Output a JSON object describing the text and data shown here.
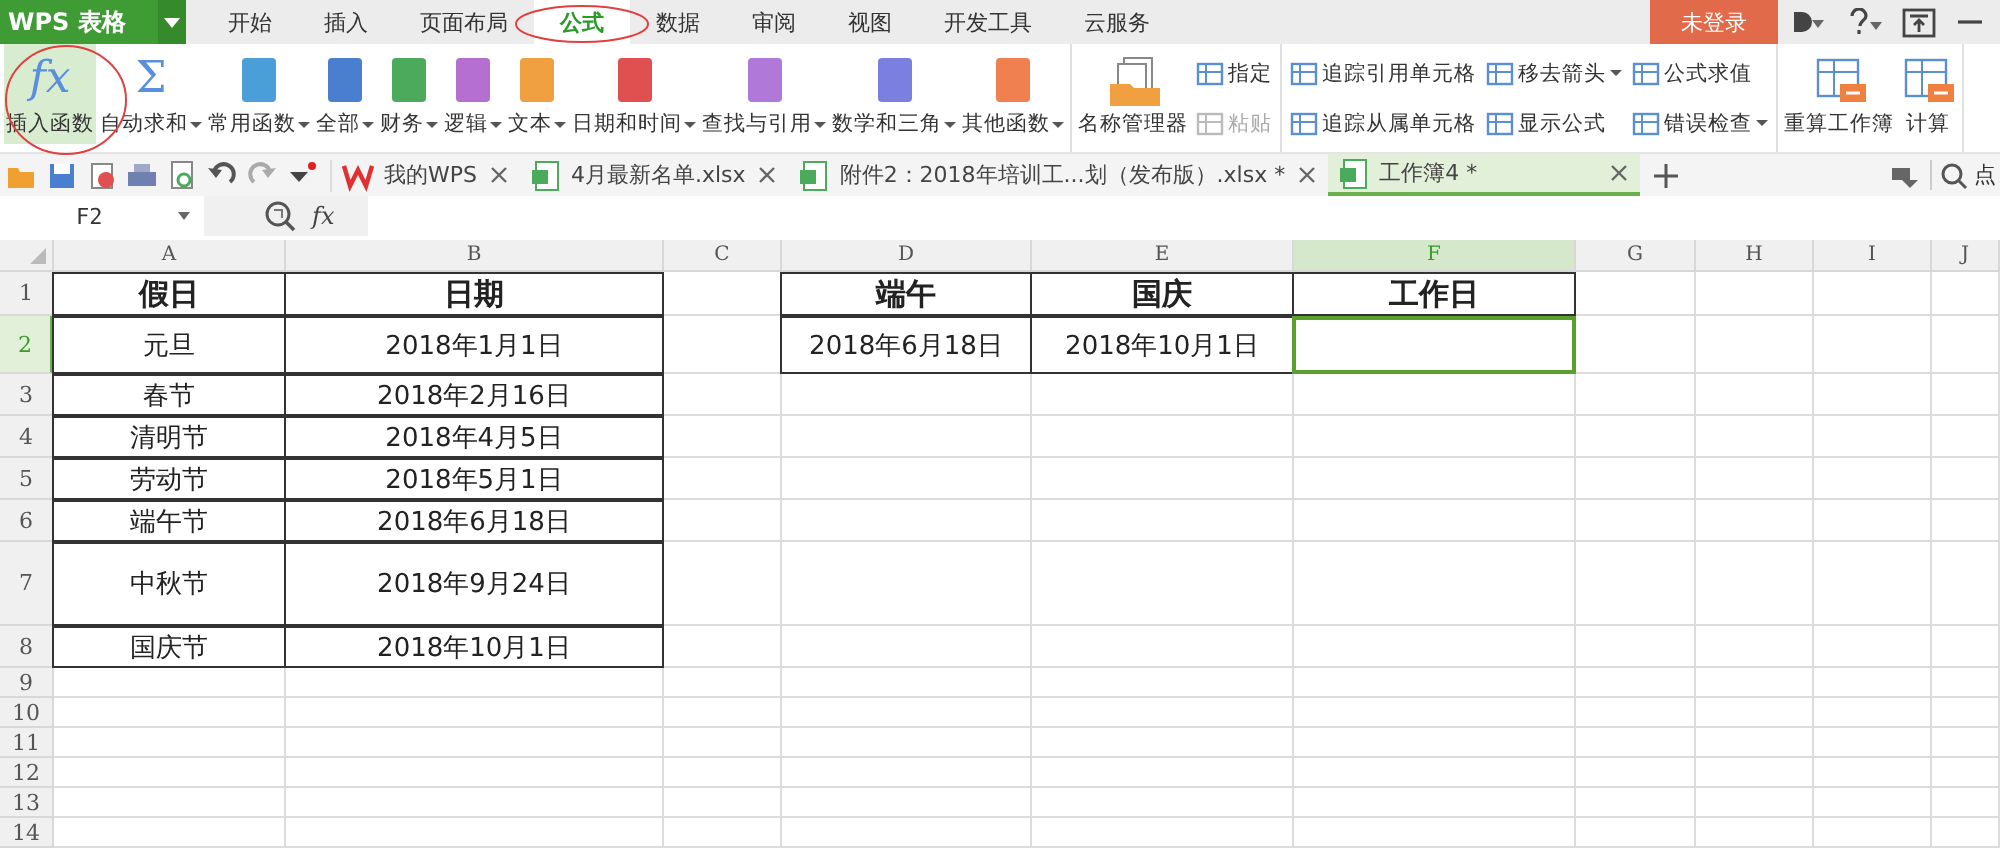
{
  "app": {
    "name": "WPS 表格"
  },
  "menu_tabs": [
    {
      "label": "开始",
      "selected": false
    },
    {
      "label": "插入",
      "selected": false
    },
    {
      "label": "页面布局",
      "selected": false
    },
    {
      "label": "公式",
      "selected": true
    },
    {
      "label": "数据",
      "selected": false
    },
    {
      "label": "审阅",
      "selected": false
    },
    {
      "label": "视图",
      "selected": false
    },
    {
      "label": "开发工具",
      "selected": false
    },
    {
      "label": "云服务",
      "selected": false
    }
  ],
  "login_button": "未登录",
  "ribbon": [
    {
      "items": [
        {
          "kind": "symbol",
          "symbol": "fx",
          "label": "插入函数",
          "dropdown": false,
          "selected": true
        },
        {
          "kind": "symbol",
          "symbol": "Σ",
          "label": "自动求和",
          "dropdown": true,
          "selected": false
        },
        {
          "kind": "category",
          "color": "#4a9fd8",
          "label": "常用函数",
          "dropdown": true,
          "selected": false
        },
        {
          "kind": "category",
          "color": "#4a7fd0",
          "label": "全部",
          "dropdown": true,
          "selected": false
        },
        {
          "kind": "category",
          "color": "#4caa5c",
          "label": "财务",
          "dropdown": true,
          "selected": false
        },
        {
          "kind": "category",
          "color": "#b46fd0",
          "label": "逻辑",
          "dropdown": true,
          "selected": false
        },
        {
          "kind": "category",
          "color": "#f0a040",
          "label": "文本",
          "dropdown": true,
          "selected": false
        },
        {
          "kind": "category",
          "color": "#e05050",
          "label": "日期和时间",
          "dropdown": true,
          "selected": false
        },
        {
          "kind": "category",
          "color": "#b078d8",
          "label": "查找与引用",
          "dropdown": true,
          "selected": false
        },
        {
          "kind": "category",
          "color": "#7b7fe0",
          "label": "数学和三角",
          "dropdown": true,
          "selected": false
        },
        {
          "kind": "category",
          "color": "#f08050",
          "label": "其他函数",
          "dropdown": true,
          "selected": false
        }
      ]
    },
    {
      "items": [
        {
          "kind": "manager",
          "label": "名称管理器",
          "dropdown": false,
          "selected": false
        },
        {
          "kind": "column",
          "items": [
            {
              "label": "指定",
              "dropdown": false,
              "disabled": false
            },
            {
              "label": "粘贴",
              "dropdown": false,
              "disabled": true
            }
          ]
        }
      ]
    },
    {
      "items": [
        {
          "kind": "column",
          "items": [
            {
              "label": "追踪引用单元格",
              "dropdown": false,
              "disabled": false
            },
            {
              "label": "追踪从属单元格",
              "dropdown": false,
              "disabled": false
            }
          ]
        },
        {
          "kind": "column",
          "items": [
            {
              "label": "移去箭头",
              "dropdown": true,
              "disabled": false
            },
            {
              "label": "显示公式",
              "dropdown": false,
              "disabled": false
            }
          ]
        },
        {
          "kind": "column",
          "items": [
            {
              "label": "公式求值",
              "dropdown": false,
              "disabled": false
            },
            {
              "label": "错误检查",
              "dropdown": true,
              "disabled": false
            }
          ]
        }
      ]
    },
    {
      "items": [
        {
          "kind": "recalc",
          "label": "重算工作簿",
          "dropdown": false,
          "selected": false
        },
        {
          "kind": "recalc",
          "label": "计算",
          "dropdown": false,
          "selected": false
        }
      ]
    }
  ],
  "documents": [
    {
      "kind": "home",
      "label": "我的WPS",
      "selected": false
    },
    {
      "kind": "sheet",
      "label": "4月最新名单.xlsx",
      "selected": false
    },
    {
      "kind": "sheet",
      "label": "附件2：2018年培训工...划（发布版）.xlsx *",
      "selected": false
    },
    {
      "kind": "sheet",
      "label": "工作簿4 *",
      "selected": true
    }
  ],
  "search_label": "点",
  "formula_bar": {
    "cell_reference": "F2",
    "function_symbol": "fx"
  },
  "columns": [
    {
      "label": "A",
      "selected": false
    },
    {
      "label": "B",
      "selected": false
    },
    {
      "label": "C",
      "selected": false
    },
    {
      "label": "D",
      "selected": false
    },
    {
      "label": "E",
      "selected": false
    },
    {
      "label": "F",
      "selected": true
    },
    {
      "label": "G",
      "selected": false
    },
    {
      "label": "H",
      "selected": false
    },
    {
      "label": "I",
      "selected": false
    },
    {
      "label": "J",
      "selected": false
    }
  ],
  "rows": [
    {
      "number": "1",
      "kind": "header",
      "selected": false,
      "cells": [
        {
          "text": "假日",
          "bold": true,
          "bordered": true,
          "selected": false
        },
        {
          "text": "日期",
          "bold": true,
          "bordered": true,
          "selected": false
        },
        {
          "bordered": false,
          "selected": false
        },
        {
          "text": "端午",
          "bold": true,
          "bordered": true,
          "selected": false
        },
        {
          "text": "国庆",
          "bold": true,
          "bordered": true,
          "selected": false
        },
        {
          "text": "工作日",
          "bold": true,
          "bordered": true,
          "selected": false
        }
      ]
    },
    {
      "number": "2",
      "kind": "medium",
      "selected": true,
      "cells": [
        {
          "text": "元旦",
          "bold": false,
          "bordered": true,
          "selected": false
        },
        {
          "text": "2018年1月1日",
          "bold": false,
          "bordered": true,
          "selected": false
        },
        {
          "bordered": false,
          "selected": false
        },
        {
          "text": "2018年6月18日",
          "bold": false,
          "bordered": true,
          "selected": false
        },
        {
          "text": "2018年10月1日",
          "bold": false,
          "bordered": true,
          "selected": false
        },
        {
          "bordered": true,
          "selected": true
        }
      ]
    },
    {
      "number": "3",
      "kind": "normal",
      "selected": false,
      "cells": [
        {
          "text": "春节",
          "bold": false,
          "bordered": true,
          "selected": false
        },
        {
          "text": "2018年2月16日",
          "bold": false,
          "bordered": true,
          "selected": false
        }
      ]
    },
    {
      "number": "4",
      "kind": "normal",
      "selected": false,
      "cells": [
        {
          "text": "清明节",
          "bold": false,
          "bordered": true,
          "selected": false
        },
        {
          "text": "2018年4月5日",
          "bold": false,
          "bordered": true,
          "selected": false
        }
      ]
    },
    {
      "number": "5",
      "kind": "normal",
      "selected": false,
      "cells": [
        {
          "text": "劳动节",
          "bold": false,
          "bordered": true,
          "selected": false
        },
        {
          "text": "2018年5月1日",
          "bold": false,
          "bordered": true,
          "selected": false
        }
      ]
    },
    {
      "number": "6",
      "kind": "normal",
      "selected": false,
      "cells": [
        {
          "text": "端午节",
          "bold": false,
          "bordered": true,
          "selected": false
        },
        {
          "text": "2018年6月18日",
          "bold": false,
          "bordered": true,
          "selected": false
        }
      ]
    },
    {
      "number": "7",
      "kind": "tall",
      "selected": false,
      "cells": [
        {
          "text": "中秋节",
          "bold": false,
          "bordered": true,
          "selected": false
        },
        {
          "text": "2018年9月24日",
          "bold": false,
          "bordered": true,
          "selected": false
        }
      ]
    },
    {
      "number": "8",
      "kind": "normal",
      "selected": false,
      "cells": [
        {
          "text": "国庆节",
          "bold": false,
          "bordered": true,
          "selected": false
        },
        {
          "text": "2018年10月1日",
          "bold": false,
          "bordered": true,
          "selected": false
        }
      ]
    },
    {
      "number": "9",
      "kind": "short",
      "selected": false
    },
    {
      "number": "10",
      "kind": "short",
      "selected": false
    },
    {
      "number": "11",
      "kind": "short",
      "selected": false
    },
    {
      "number": "12",
      "kind": "short",
      "selected": false
    },
    {
      "number": "13",
      "kind": "short",
      "selected": false
    },
    {
      "number": "14",
      "kind": "short",
      "selected": false
    }
  ]
}
